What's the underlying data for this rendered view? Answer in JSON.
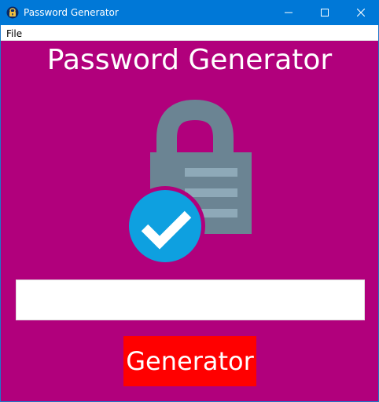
{
  "window": {
    "title": "Password Generator",
    "icon": "lock-app-icon",
    "controls": [
      "minimize-icon",
      "maximize-icon",
      "close-icon"
    ]
  },
  "menu": {
    "items": [
      {
        "label": "File"
      }
    ]
  },
  "main": {
    "heading": "Password Generator",
    "illustration": "lock-check-icon",
    "password_value": "",
    "button_label": "Generator"
  },
  "colors": {
    "titlebar": "#0078d7",
    "background": "#b1007c",
    "button": "#ff0000",
    "lock_body": "#6b8493",
    "lock_stripes": "#8ea9b8",
    "check_circle": "#0ea0e0"
  }
}
